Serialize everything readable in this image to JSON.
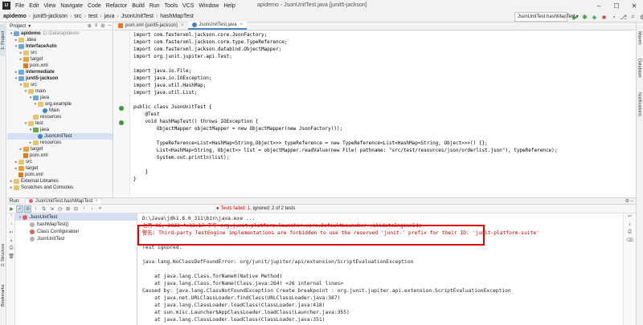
{
  "menubar": {
    "items": [
      "File",
      "Edit",
      "View",
      "Navigate",
      "Code",
      "Refactor",
      "Build",
      "Run",
      "Tools",
      "VCS",
      "Window",
      "Help"
    ],
    "window_title": "apidemo - JsonUnitTest.java [junit5-jackson]"
  },
  "navbar": {
    "crumbs": [
      "apidemo",
      "junit5-jackson",
      "src",
      "test",
      "java",
      "JsonUnitTest",
      "hashMapTest"
    ],
    "run_config": "JsonUnitTest.hashMapTest"
  },
  "left_strip": {
    "project_tab": "1: Project",
    "structure_tab": "2: Structure",
    "bookmarks_tab": "Bookmarks"
  },
  "right_strip": {
    "maven_tab": "Maven",
    "database_tab": "Database",
    "notifications_tab": "Notifications"
  },
  "project": {
    "header": "Project",
    "tree": [
      {
        "label": "apidemo",
        "suffix": "D:\\Data\\apidemo",
        "icon": "module-folder-icon",
        "indent": 0,
        "arrow": "v",
        "bold": true
      },
      {
        "label": ".idea",
        "icon": "folder-icon",
        "indent": 1,
        "arrow": ">"
      },
      {
        "label": "InterfaceAuto",
        "icon": "module-folder-icon",
        "indent": 1,
        "arrow": "v",
        "bold": true
      },
      {
        "label": "src",
        "icon": "folder-icon",
        "indent": 2,
        "arrow": ">"
      },
      {
        "label": "target",
        "icon": "orange-folder-icon",
        "indent": 2,
        "arrow": ">"
      },
      {
        "label": "pom.xml",
        "icon": "xml-file-icon",
        "indent": 2,
        "arrow": ""
      },
      {
        "label": "intermediate",
        "icon": "module-folder-icon",
        "indent": 1,
        "arrow": ">",
        "bold": true
      },
      {
        "label": "junit5-jackson",
        "icon": "module-folder-icon",
        "indent": 1,
        "arrow": "v",
        "bold": true
      },
      {
        "label": "src",
        "icon": "folder-icon",
        "indent": 2,
        "arrow": "v"
      },
      {
        "label": "main",
        "icon": "folder-icon",
        "indent": 3,
        "arrow": "v"
      },
      {
        "label": "java",
        "icon": "blue-folder-icon",
        "indent": 4,
        "arrow": "v"
      },
      {
        "label": "org.example",
        "icon": "folder-icon",
        "indent": 5,
        "arrow": "v"
      },
      {
        "label": "Main",
        "icon": "class-file-icon",
        "indent": 6,
        "arrow": ""
      },
      {
        "label": "resources",
        "icon": "folder-icon",
        "indent": 4,
        "arrow": ""
      },
      {
        "label": "test",
        "icon": "folder-icon",
        "indent": 3,
        "arrow": "v"
      },
      {
        "label": "java",
        "icon": "green-folder-icon",
        "indent": 4,
        "arrow": "v"
      },
      {
        "label": "JsonUnitTest",
        "icon": "class-file-icon",
        "indent": 5,
        "arrow": "",
        "selected": true
      },
      {
        "label": "resources",
        "icon": "folder-icon",
        "indent": 4,
        "arrow": ">"
      },
      {
        "label": "target",
        "icon": "orange-folder-icon",
        "indent": 2,
        "arrow": ">"
      },
      {
        "label": "pom.xml",
        "icon": "xml-file-icon",
        "indent": 2,
        "arrow": ""
      },
      {
        "label": "src",
        "icon": "folder-icon",
        "indent": 1,
        "arrow": ">"
      },
      {
        "label": "target",
        "icon": "orange-folder-icon",
        "indent": 1,
        "arrow": ">"
      },
      {
        "label": "pom.xml",
        "icon": "xml-file-icon",
        "indent": 1,
        "arrow": ""
      },
      {
        "label": "External Libraries",
        "icon": "library-icon",
        "indent": 0,
        "arrow": ">"
      },
      {
        "label": "Scratches and Consoles",
        "icon": "scratch-icon",
        "indent": 0,
        "arrow": ">"
      }
    ]
  },
  "editor_tabs": [
    {
      "label": "pom.xml (junit5-jackson)",
      "active": false,
      "icon": "xml-file-icon"
    },
    {
      "label": "JsonUnitTest.java",
      "active": true,
      "icon": "class-file-icon"
    }
  ],
  "code": [
    "import com.fasterxml.jackson.core.JsonFactory;",
    "import com.fasterxml.jackson.core.type.TypeReference;",
    "import com.fasterxml.jackson.databind.ObjectMapper;",
    "import org.junit.jupiter.api.Test;",
    "",
    "import java.io.File;",
    "import java.io.IOException;",
    "import java.util.HashMap;",
    "import java.util.List;",
    "",
    "public class JsonUnitTest {",
    "    @Test",
    "    void hashMapTest() throws IOException {",
    "        ObjectMapper objectMapper = new ObjectMapper(new JsonFactory());",
    "",
    "        TypeReference<List<HashMap<String,Object>>> typeReference = new TypeReference<List<HashMap<String, Object>>>() {};",
    "        List<HashMap<String, Object>> list = objectMapper.readValue(new File( pathname: \"src/test/resources/json/orderlist.json\"), typeReference);",
    "        System.out.println(list);",
    "",
    "    }",
    "}"
  ],
  "run": {
    "label": "Run:",
    "tab": "JsonUnitTest.hashMapTest",
    "status_failed": "Tests failed: 1,",
    "status_rest": " ignored: 2 of 2 tests",
    "tree": [
      {
        "label": "JsonUnitTest",
        "icon": "error-icon",
        "indent": 0
      },
      {
        "label": "hashMapTest()",
        "icon": "ignored-icon",
        "indent": 1
      },
      {
        "label": "Class Configuration",
        "icon": "error-icon",
        "indent": 1
      },
      {
        "label": "JsonUnitTest",
        "icon": "ignored-icon",
        "indent": 1
      }
    ]
  },
  "console": {
    "lines": [
      {
        "text": "D:\\Java\\jdk1.8.0_311\\bin\\java.exe ...",
        "style": ""
      },
      {
        "text": "七月 06, 2023 4:13:17 下午 org.junit.platform.launcher.core.DefaultLauncher validateEngineIds",
        "style": "red"
      },
      {
        "text": "警告: Third-party TestEngine implementations are forbidden to use the reserved 'junit-' prefix for their ID: 'junit-platform-suite'",
        "style": "red"
      },
      {
        "text": "",
        "style": ""
      },
      {
        "text": "Test ignored.",
        "style": ""
      },
      {
        "text": "",
        "style": ""
      },
      {
        "text": "java.lang.NoClassDefFoundError: org/junit/jupiter/api/extension/ScriptEvaluationException",
        "style": ""
      },
      {
        "text": "",
        "style": ""
      },
      {
        "text": "    at java.lang.Class.forName0(Native Method)",
        "style": ""
      },
      {
        "text": "    at java.lang.Class.forName(Class.java:264) <26 internal lines>",
        "style": ""
      },
      {
        "text": "Caused by: java.lang.ClassNotFoundException Create breakpoint : org.junit.jupiter.api.extension.ScriptEvaluationException",
        "style": ""
      },
      {
        "text": "    at java.net.URLClassLoader.findClass(URLClassLoader.java:387)",
        "style": ""
      },
      {
        "text": "    at java.lang.ClassLoader.loadClass(ClassLoader.java:418)",
        "style": ""
      },
      {
        "text": "    at sun.misc.Launcher$AppClassLoader.loadClass(Launcher.java:355)",
        "style": ""
      },
      {
        "text": "    at java.lang.ClassLoader.loadClass(ClassLoader.java:351)",
        "style": ""
      }
    ]
  },
  "colors": {
    "accent": "#4a88c7",
    "error": "#c00000",
    "highlight_box": "#e00000",
    "selection": "#d5e1f2"
  }
}
